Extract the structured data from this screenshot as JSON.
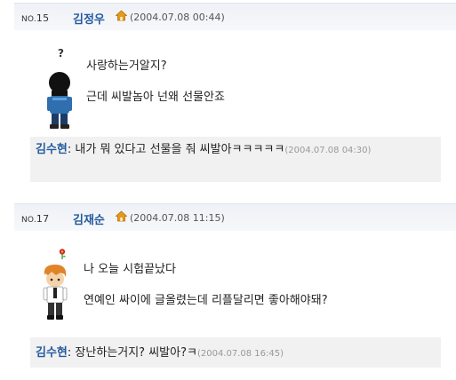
{
  "posts": [
    {
      "no_prefix": "NO.",
      "no": "15",
      "author": "김정우",
      "date": "(2004.07.08 00:44)",
      "lines": [
        "사랑하는거알지?",
        "근데 씨발놈아 넌왜 선물안죠"
      ],
      "comment": {
        "name": "김수현",
        "sep": ": ",
        "text": "내가 뭐 있다고 선물을 줘 씨발아ㅋㅋㅋㅋㅋ",
        "date": "(2004.07.08 04:30)"
      }
    },
    {
      "no_prefix": "NO.",
      "no": "17",
      "author": "김재순",
      "date": "(2004.07.08 11:15)",
      "lines": [
        "나 오늘 시험끝났다",
        "연예인 싸이에 글올렸는데 리플달리면 좋아해야돼?"
      ],
      "comment": {
        "name": "김수현",
        "sep": ": ",
        "text": "장난하는거지? 씨발아?ㅋ",
        "date": "(2004.07.08 16:45)"
      }
    }
  ],
  "icons": {
    "house": "house-icon",
    "avatar_1": "avatar-boy-icon",
    "emote_1": "question-mark-icon",
    "avatar_2": "avatar-orange-hair-icon",
    "emote_2": "flower-icon"
  },
  "colors": {
    "author": "#245a9e",
    "house": "#e49a1a",
    "header_bg": "#eef1f6",
    "comment_bg": "#f1f1f1"
  }
}
